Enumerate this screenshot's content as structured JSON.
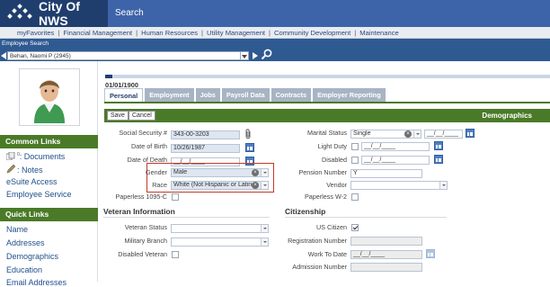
{
  "app": {
    "title": "City Of NWS",
    "search": "Search"
  },
  "menu": [
    "myFavorites",
    "Financial Management",
    "Human Resources",
    "Utility Management",
    "Community Development",
    "Maintenance"
  ],
  "employee_bar": {
    "label": "Employee Search",
    "selected": "Behan, Naomi P (2945)"
  },
  "sidebar": {
    "common_links": {
      "title": "Common Links",
      "items": [
        {
          "label": ": Documents",
          "icon": "documents-icon"
        },
        {
          "label": ": Notes",
          "icon": "notes-icon"
        },
        {
          "label": "eSuite Access"
        },
        {
          "label": "Employee Service"
        }
      ]
    },
    "quick_links": {
      "title": "Quick Links",
      "items": [
        "Name",
        "Addresses",
        "Demographics",
        "Education",
        "Email Addresses"
      ]
    }
  },
  "record": {
    "date": "01/01/1900"
  },
  "tabs": [
    {
      "label": "Personal",
      "active": true
    },
    {
      "label": "Employment"
    },
    {
      "label": "Jobs"
    },
    {
      "label": "Payroll Data"
    },
    {
      "label": "Contracts"
    },
    {
      "label": "Employer Reporting"
    }
  ],
  "actions": {
    "save": "Save",
    "cancel": "Cancel",
    "section_title": "Demographics"
  },
  "demographics": {
    "ssn": {
      "label": "Social Security #",
      "value": "343-00-3203"
    },
    "dob": {
      "label": "Date of Birth",
      "value": "10/26/1987"
    },
    "dod": {
      "label": "Date of Death",
      "value": "__/__/____"
    },
    "gender": {
      "label": "Gender",
      "value": "Male"
    },
    "race": {
      "label": "Race",
      "value": "White (Not Hispanic or Latino"
    },
    "paperless_1095c": {
      "label": "Paperless 1095-C",
      "checked": false
    },
    "marital_status": {
      "label": "Marital Status",
      "value": "Single",
      "date": "__/__/____"
    },
    "light_duty": {
      "label": "Light Duty",
      "checked": false,
      "date": "__/__/____"
    },
    "disabled": {
      "label": "Disabled",
      "checked": false,
      "date": "__/__/____"
    },
    "pension_number": {
      "label": "Pension Number",
      "value": "Y"
    },
    "vendor": {
      "label": "Vendor",
      "value": ""
    },
    "paperless_w2": {
      "label": "Paperless W-2",
      "checked": false
    }
  },
  "veteran": {
    "title": "Veteran Information",
    "status": {
      "label": "Veteran Status",
      "value": ""
    },
    "branch": {
      "label": "Military Branch",
      "value": ""
    },
    "disabled": {
      "label": "Disabled Veteran",
      "checked": false
    }
  },
  "citizenship": {
    "title": "Citizenship",
    "us_citizen": {
      "label": "US Citizen",
      "checked": true
    },
    "registration": {
      "label": "Registration Number",
      "value": ""
    },
    "work_to_date": {
      "label": "Work To Date",
      "value": "__/__/____"
    },
    "admission": {
      "label": "Admission Number",
      "value": ""
    }
  },
  "colors": {
    "header": "#1f3e6e",
    "search": "#3d64a8",
    "green": "#4a7a27",
    "highlight": "#c0392b"
  }
}
